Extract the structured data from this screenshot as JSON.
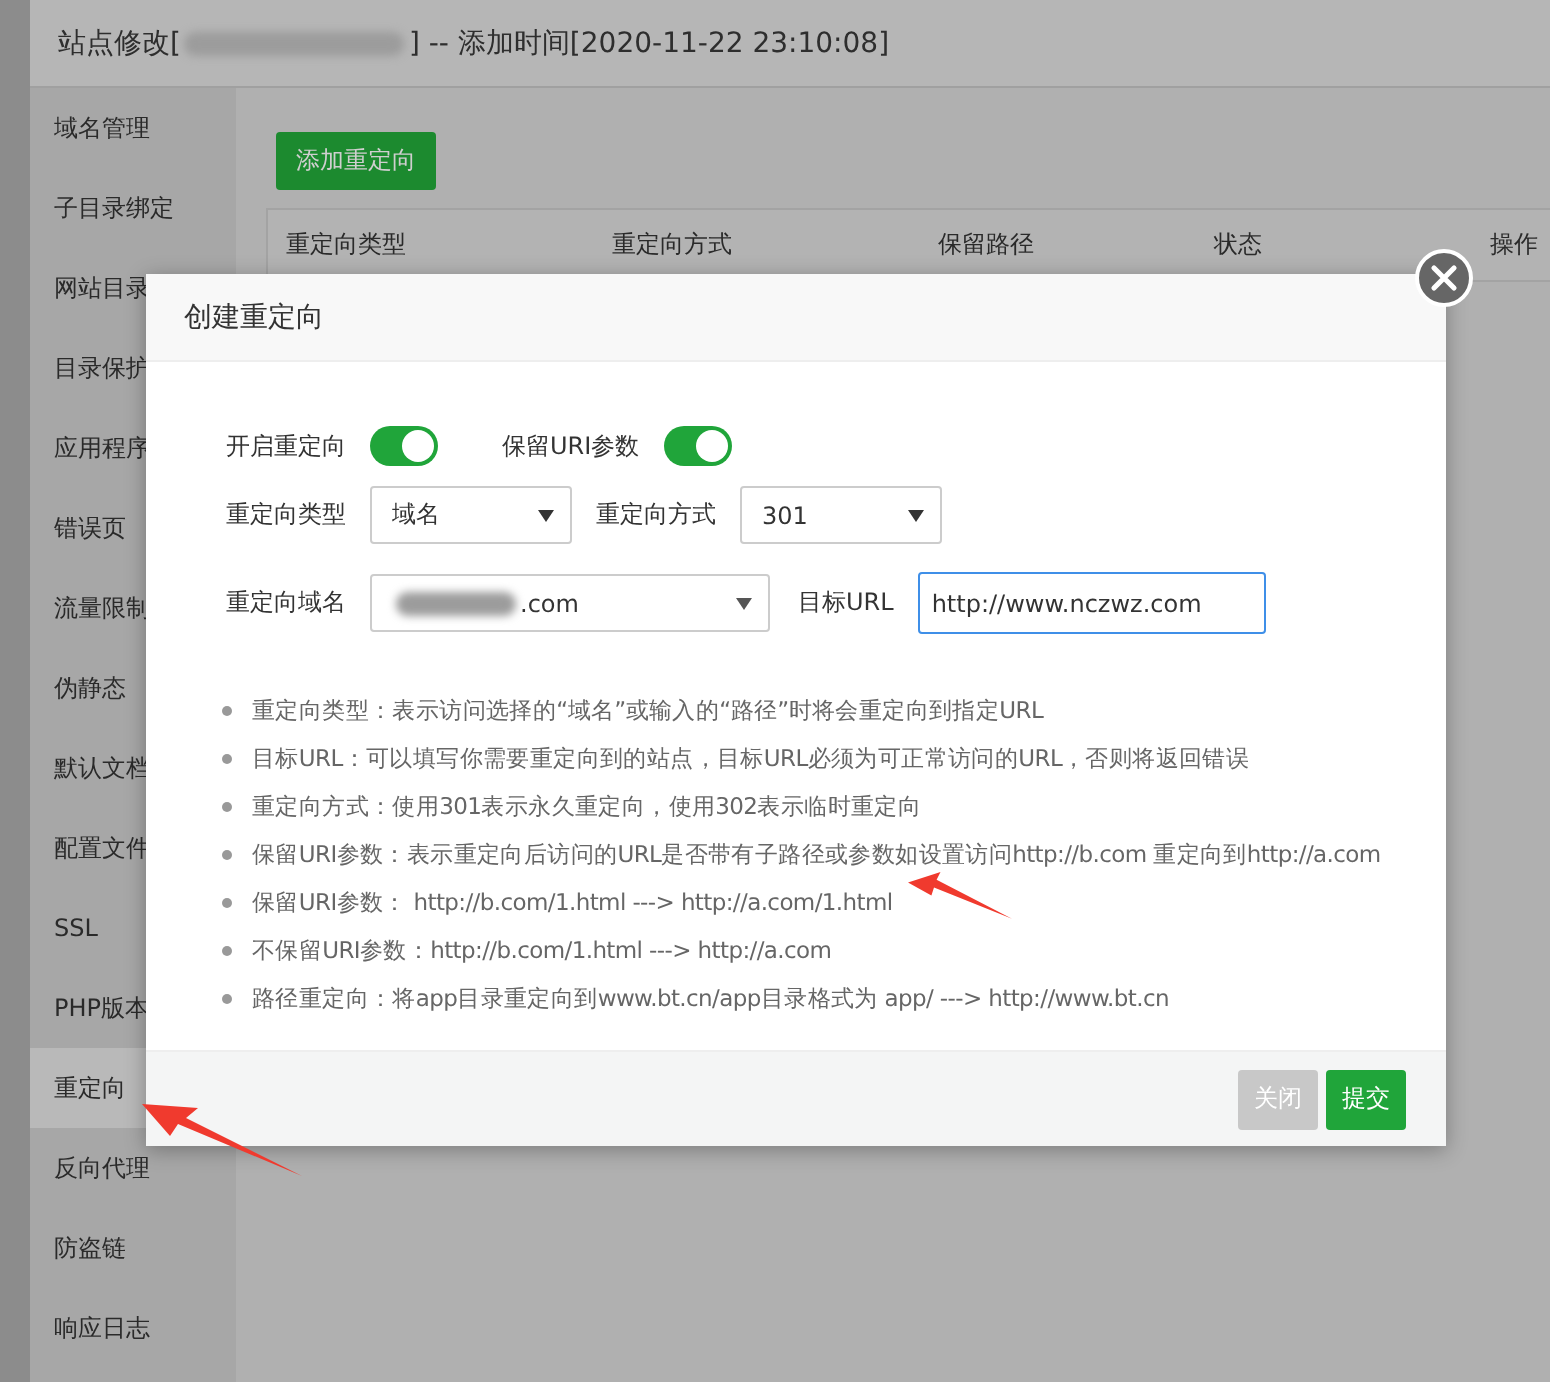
{
  "site_dialog": {
    "title_prefix": "站点修改[",
    "title_suffix": "] -- 添加时间[2020-11-22 23:10:08]"
  },
  "sidebar": {
    "items": [
      {
        "label": "域名管理",
        "selected": false
      },
      {
        "label": "子目录绑定",
        "selected": false
      },
      {
        "label": "网站目录",
        "selected": false
      },
      {
        "label": "目录保护",
        "selected": false
      },
      {
        "label": "应用程序",
        "selected": false
      },
      {
        "label": "错误页",
        "selected": false
      },
      {
        "label": "流量限制",
        "selected": false
      },
      {
        "label": "伪静态",
        "selected": false
      },
      {
        "label": "默认文档",
        "selected": false
      },
      {
        "label": "配置文件",
        "selected": false
      },
      {
        "label": "SSL",
        "selected": false
      },
      {
        "label": "PHP版本",
        "selected": false
      },
      {
        "label": "重定向",
        "selected": true
      },
      {
        "label": "反向代理",
        "selected": false
      },
      {
        "label": "防盗链",
        "selected": false
      },
      {
        "label": "响应日志",
        "selected": false
      }
    ]
  },
  "add_button": "添加重定向",
  "table": {
    "columns": [
      "重定向类型",
      "重定向方式",
      "保留路径",
      "状态",
      "操作"
    ]
  },
  "modal": {
    "title": "创建重定向",
    "switches": [
      {
        "label": "开启重定向",
        "on": true
      },
      {
        "label": "保留URI参数",
        "on": true
      }
    ],
    "selects": [
      {
        "label": "重定向类型",
        "value": "域名"
      },
      {
        "label": "重定向方式",
        "value": "301"
      }
    ],
    "domain": {
      "label": "重定向域名",
      "value_suffix": ".com"
    },
    "target": {
      "label": "目标URL",
      "value": "http://www.nczwz.com"
    },
    "notes": [
      "重定向类型：表示访问选择的“域名”或输入的“路径”时将会重定向到指定URL",
      "目标URL：可以填写你需要重定向到的站点，目标URL必须为可正常访问的URL，否则将返回错误",
      "重定向方式：使用301表示永久重定向，使用302表示临时重定向",
      "保留URI参数：表示重定向后访问的URL是否带有子路径或参数如设置访问http://b.com 重定向到http://a.com",
      "保留URI参数： http://b.com/1.html ---> http://a.com/1.html",
      "不保留URI参数：http://b.com/1.html ---> http://a.com",
      "路径重定向：将app目录重定向到www.bt.cn/app目录格式为 app/ ---> http://www.bt.cn"
    ],
    "buttons": [
      {
        "label": "关闭",
        "kind": "secondary"
      },
      {
        "label": "提交",
        "kind": "primary"
      }
    ]
  }
}
